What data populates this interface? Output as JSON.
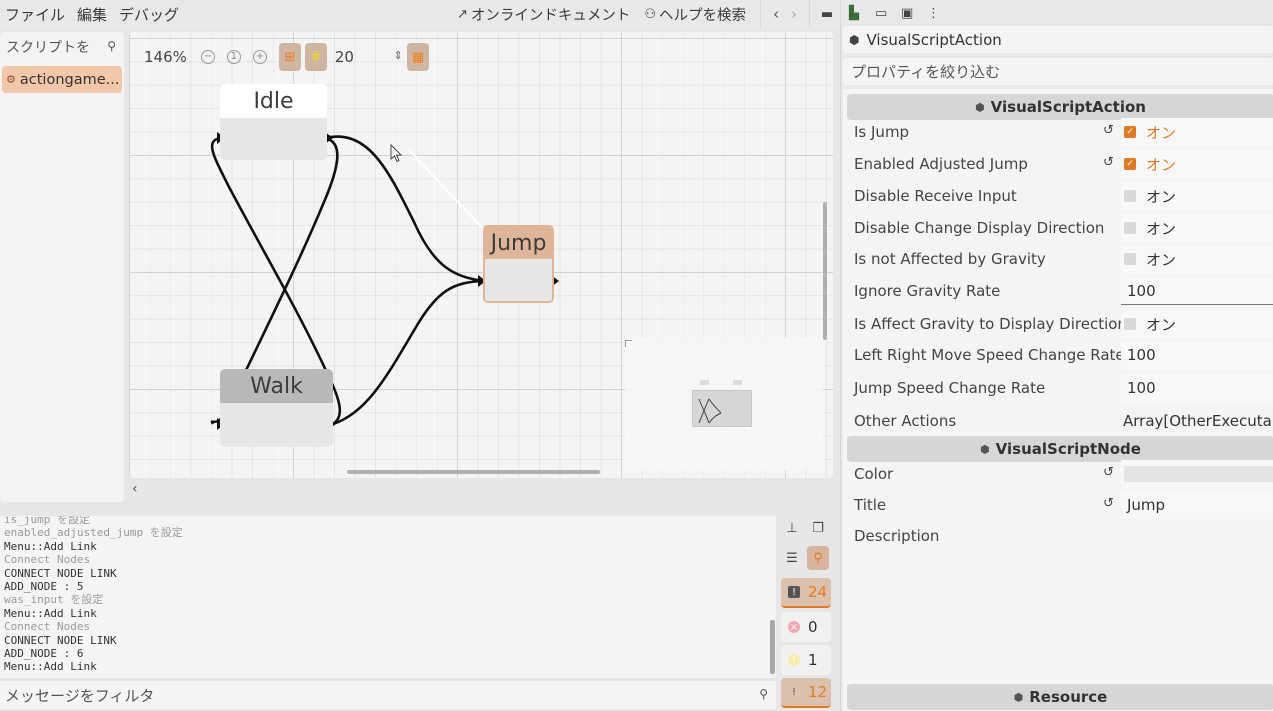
{
  "menubar": {
    "items": [
      "ファイル",
      "編集",
      "デバッグ"
    ],
    "online_docs": "オンラインドキュメント",
    "search_help": "ヘルプを検索",
    "prev": "‹",
    "next": "›"
  },
  "scripts_panel": {
    "filter_placeholder": "スクリプトを",
    "items": [
      {
        "label": "actiongame...",
        "selected": true
      }
    ]
  },
  "graph": {
    "zoom": "146%",
    "zoom_out": "−",
    "zoom_reset": "1",
    "zoom_in": "+",
    "snap_value": "20",
    "nodes": [
      {
        "title": "Idle",
        "style": "default"
      },
      {
        "title": "Jump",
        "style": "selected"
      },
      {
        "title": "Walk",
        "style": "gray"
      }
    ],
    "links": [
      {
        "from": "Idle",
        "to": "Jump"
      },
      {
        "from": "Idle",
        "to": "Walk"
      },
      {
        "from": "Walk",
        "to": "Idle"
      },
      {
        "from": "Walk",
        "to": "Jump"
      }
    ],
    "collapse_label": "‹"
  },
  "output": {
    "lines": [
      {
        "text": "is_jump を設定",
        "style": "dim"
      },
      {
        "text": "enabled_adjusted_jump を設定",
        "style": "dim"
      },
      {
        "text": "Menu::Add Link",
        "style": "normal"
      },
      {
        "text": "Connect Nodes",
        "style": "dim"
      },
      {
        "text": "CONNECT NODE LINK",
        "style": "normal"
      },
      {
        "text": "ADD_NODE : 5",
        "style": "normal"
      },
      {
        "text": "was_input を設定",
        "style": "dim"
      },
      {
        "text": "Menu::Add Link",
        "style": "normal"
      },
      {
        "text": "Connect Nodes",
        "style": "dim"
      },
      {
        "text": "CONNECT NODE LINK",
        "style": "normal"
      },
      {
        "text": "ADD_NODE : 6",
        "style": "normal"
      },
      {
        "text": "Menu::Add Link",
        "style": "normal"
      }
    ],
    "filter_placeholder": "メッセージをフィルタ",
    "counts": {
      "messages": "24",
      "errors": "0",
      "warnings": "1",
      "editor": "12"
    }
  },
  "inspector": {
    "object_name": "VisualScriptAction",
    "filter_placeholder": "プロパティを絞り込む",
    "sections": [
      {
        "title": "VisualScriptAction",
        "properties": [
          {
            "label": "Is Jump",
            "type": "bool",
            "value": true,
            "text": "オン",
            "revertable": true
          },
          {
            "label": "Enabled Adjusted Jump",
            "type": "bool",
            "value": true,
            "text": "オン",
            "revertable": true
          },
          {
            "label": "Disable Receive Input",
            "type": "bool",
            "value": false,
            "text": "オン",
            "revertable": false
          },
          {
            "label": "Disable Change Display Direction",
            "type": "bool",
            "value": false,
            "text": "オン",
            "revertable": false
          },
          {
            "label": "Is not Affected by Gravity",
            "type": "bool",
            "value": false,
            "text": "オン",
            "revertable": false
          },
          {
            "label": "Ignore Gravity Rate",
            "type": "number",
            "text": "100",
            "revertable": false
          },
          {
            "label": "Is Affect Gravity to Display Direction",
            "type": "bool",
            "value": false,
            "text": "オン",
            "revertable": false
          },
          {
            "label": "Left Right Move Speed Change Rate",
            "type": "number",
            "text": "100",
            "revertable": false
          },
          {
            "label": "Jump Speed Change Rate",
            "type": "number",
            "text": "100",
            "revertable": false
          },
          {
            "label": "Other Actions",
            "type": "array",
            "text": "Array[OtherExecutable",
            "revertable": false
          }
        ]
      },
      {
        "title": "VisualScriptNode",
        "properties": [
          {
            "label": "Color",
            "type": "color",
            "value": "#e3e3e3",
            "revertable": true
          },
          {
            "label": "Title",
            "type": "string",
            "text": "Jump",
            "revertable": true
          },
          {
            "label": "Description",
            "type": "string",
            "text": "",
            "revertable": false
          }
        ]
      },
      {
        "title": "Resource",
        "properties": []
      }
    ]
  },
  "colors": {
    "accent": "#e07a22",
    "selected_node_title": "#deb598",
    "selected_script_bg": "#f2c7a9"
  }
}
